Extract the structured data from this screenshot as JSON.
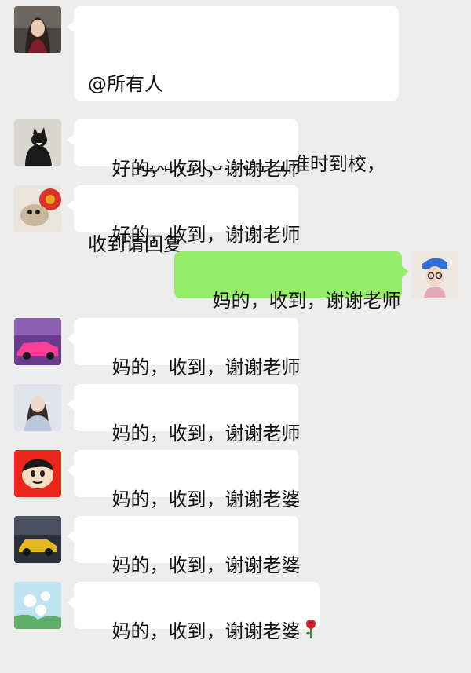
{
  "messages": [
    {
      "sender": "teacher",
      "direction": "in",
      "lines": [
        "@所有人",
        "        通知明天8:00学生准时到校，",
        "收到请回复"
      ],
      "avatar_icon": "girl-portrait-avatar-icon"
    },
    {
      "sender": "parent-1",
      "direction": "in",
      "text": "好的，收到，谢谢老师",
      "avatar_icon": "cat-avatar-icon"
    },
    {
      "sender": "parent-2",
      "direction": "in",
      "text": "好的，收到，谢谢老师",
      "avatar_icon": "dog-avatar-icon"
    },
    {
      "sender": "me",
      "direction": "out",
      "text": "妈的，收到，谢谢老师",
      "avatar_icon": "girl-blue-hat-avatar-icon"
    },
    {
      "sender": "parent-3",
      "direction": "in",
      "text": "妈的，收到，谢谢老师",
      "avatar_icon": "pink-car-avatar-icon"
    },
    {
      "sender": "parent-4",
      "direction": "in",
      "text": "妈的，收到，谢谢老师",
      "avatar_icon": "girl-avatar-icon"
    },
    {
      "sender": "parent-5",
      "direction": "in",
      "text": "妈的，收到，谢谢老婆",
      "avatar_icon": "cartoon-boy-avatar-icon"
    },
    {
      "sender": "parent-6",
      "direction": "in",
      "text": "妈的，收到，谢谢老婆",
      "avatar_icon": "yellow-car-avatar-icon"
    },
    {
      "sender": "parent-7",
      "direction": "in",
      "text": "妈的，收到，谢谢老婆",
      "emoji": "rose-icon",
      "avatar_icon": "flower-avatar-icon"
    }
  ],
  "colors": {
    "background": "#ededed",
    "incoming_bubble": "#ffffff",
    "outgoing_bubble": "#95ec69"
  }
}
